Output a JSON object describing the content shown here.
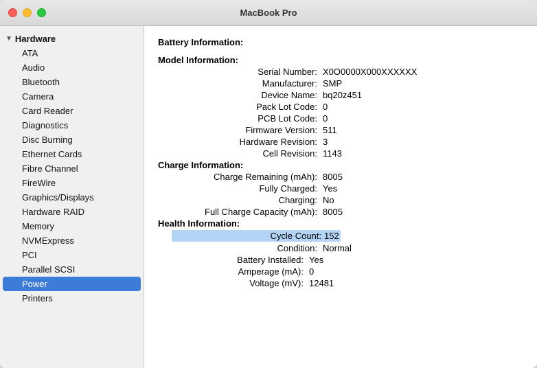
{
  "window": {
    "title": "MacBook Pro"
  },
  "trafficLights": {
    "close": "close",
    "minimize": "minimize",
    "maximize": "maximize"
  },
  "sidebar": {
    "sectionHeader": "Hardware",
    "items": [
      {
        "id": "ata",
        "label": "ATA",
        "selected": false
      },
      {
        "id": "audio",
        "label": "Audio",
        "selected": false
      },
      {
        "id": "bluetooth",
        "label": "Bluetooth",
        "selected": false
      },
      {
        "id": "camera",
        "label": "Camera",
        "selected": false
      },
      {
        "id": "card-reader",
        "label": "Card Reader",
        "selected": false
      },
      {
        "id": "diagnostics",
        "label": "Diagnostics",
        "selected": false
      },
      {
        "id": "disc-burning",
        "label": "Disc Burning",
        "selected": false
      },
      {
        "id": "ethernet-cards",
        "label": "Ethernet Cards",
        "selected": false
      },
      {
        "id": "fibre-channel",
        "label": "Fibre Channel",
        "selected": false
      },
      {
        "id": "firewire",
        "label": "FireWire",
        "selected": false
      },
      {
        "id": "graphics-displays",
        "label": "Graphics/Displays",
        "selected": false
      },
      {
        "id": "hardware-raid",
        "label": "Hardware RAID",
        "selected": false
      },
      {
        "id": "memory",
        "label": "Memory",
        "selected": false
      },
      {
        "id": "nvmexpress",
        "label": "NVMExpress",
        "selected": false
      },
      {
        "id": "pci",
        "label": "PCI",
        "selected": false
      },
      {
        "id": "parallel-scsi",
        "label": "Parallel SCSI",
        "selected": false
      },
      {
        "id": "power",
        "label": "Power",
        "selected": true
      },
      {
        "id": "printers",
        "label": "Printers",
        "selected": false
      }
    ]
  },
  "detail": {
    "title": "Battery Information:",
    "sections": [
      {
        "label": "Model Information:",
        "rows": [
          {
            "label": "Serial Number:",
            "value": "X0O0000X000XXXXXX",
            "highlighted": false
          },
          {
            "label": "Manufacturer:",
            "value": "SMP",
            "highlighted": false
          },
          {
            "label": "Device Name:",
            "value": "bq20z451",
            "highlighted": false
          },
          {
            "label": "Pack Lot Code:",
            "value": "0",
            "highlighted": false
          },
          {
            "label": "PCB Lot Code:",
            "value": "0",
            "highlighted": false
          },
          {
            "label": "Firmware Version:",
            "value": "511",
            "highlighted": false
          },
          {
            "label": "Hardware Revision:",
            "value": "3",
            "highlighted": false
          },
          {
            "label": "Cell Revision:",
            "value": "1143",
            "highlighted": false
          }
        ]
      },
      {
        "label": "Charge Information:",
        "rows": [
          {
            "label": "Charge Remaining (mAh):",
            "value": "8005",
            "highlighted": false
          },
          {
            "label": "Fully Charged:",
            "value": "Yes",
            "highlighted": false
          },
          {
            "label": "Charging:",
            "value": "No",
            "highlighted": false
          },
          {
            "label": "Full Charge Capacity (mAh):",
            "value": "8005",
            "highlighted": false
          }
        ]
      },
      {
        "label": "Health Information:",
        "rows": [
          {
            "label": "Cycle Count:",
            "value": "152",
            "highlighted": true
          },
          {
            "label": "Condition:",
            "value": "Normal",
            "highlighted": false
          }
        ]
      }
    ],
    "bottomRows": [
      {
        "label": "Battery Installed:",
        "value": "Yes"
      },
      {
        "label": "Amperage (mA):",
        "value": "0"
      },
      {
        "label": "Voltage (mV):",
        "value": "12481"
      }
    ]
  }
}
